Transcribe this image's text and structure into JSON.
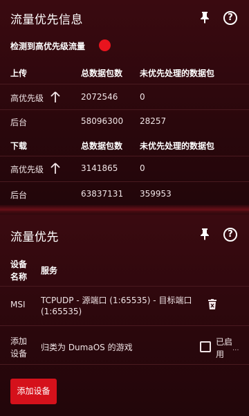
{
  "priority_info": {
    "title": "流量优先信息",
    "detected_label": "检测到高优先级流量",
    "upload": {
      "header": "上传",
      "col_total": "总数据包数",
      "col_unprioritized": "未优先处理的数据包",
      "rows": [
        {
          "label": "高优先级",
          "total": "2072546",
          "unprioritized": "0"
        },
        {
          "label": "后台",
          "total": "58096300",
          "unprioritized": "28257"
        }
      ]
    },
    "download": {
      "header": "下载",
      "col_total": "总数据包数",
      "col_unprioritized": "未优先处理的数据包",
      "rows": [
        {
          "label": "高优先级",
          "total": "3141865",
          "unprioritized": "0"
        },
        {
          "label": "后台",
          "total": "63837131",
          "unprioritized": "359953"
        }
      ]
    },
    "status_color": "#e8141e"
  },
  "traffic_priority": {
    "title": "流量优先",
    "col_device": "设备名称",
    "col_device_line1": "设备",
    "col_device_line2": "名称",
    "col_service": "服务",
    "rows": [
      {
        "device": "MSI",
        "service": "TCPUDP - 源端口 (1:65535) - 目标端口 (1:65535)",
        "service_line1": "TCPUDP - 源端口 (1:65535) - 目标端口",
        "service_line2": "(1:65535)"
      }
    ],
    "add_row": {
      "label_line1": "添加",
      "label_line2": "设备",
      "description": "归类为 DumaOS 的游戏",
      "enabled_line1": "已启",
      "enabled_line2": "用",
      "ellipsis": "..."
    },
    "add_button": "添加设备"
  },
  "colors": {
    "accent": "#d5111b",
    "background": "#2a070c"
  }
}
